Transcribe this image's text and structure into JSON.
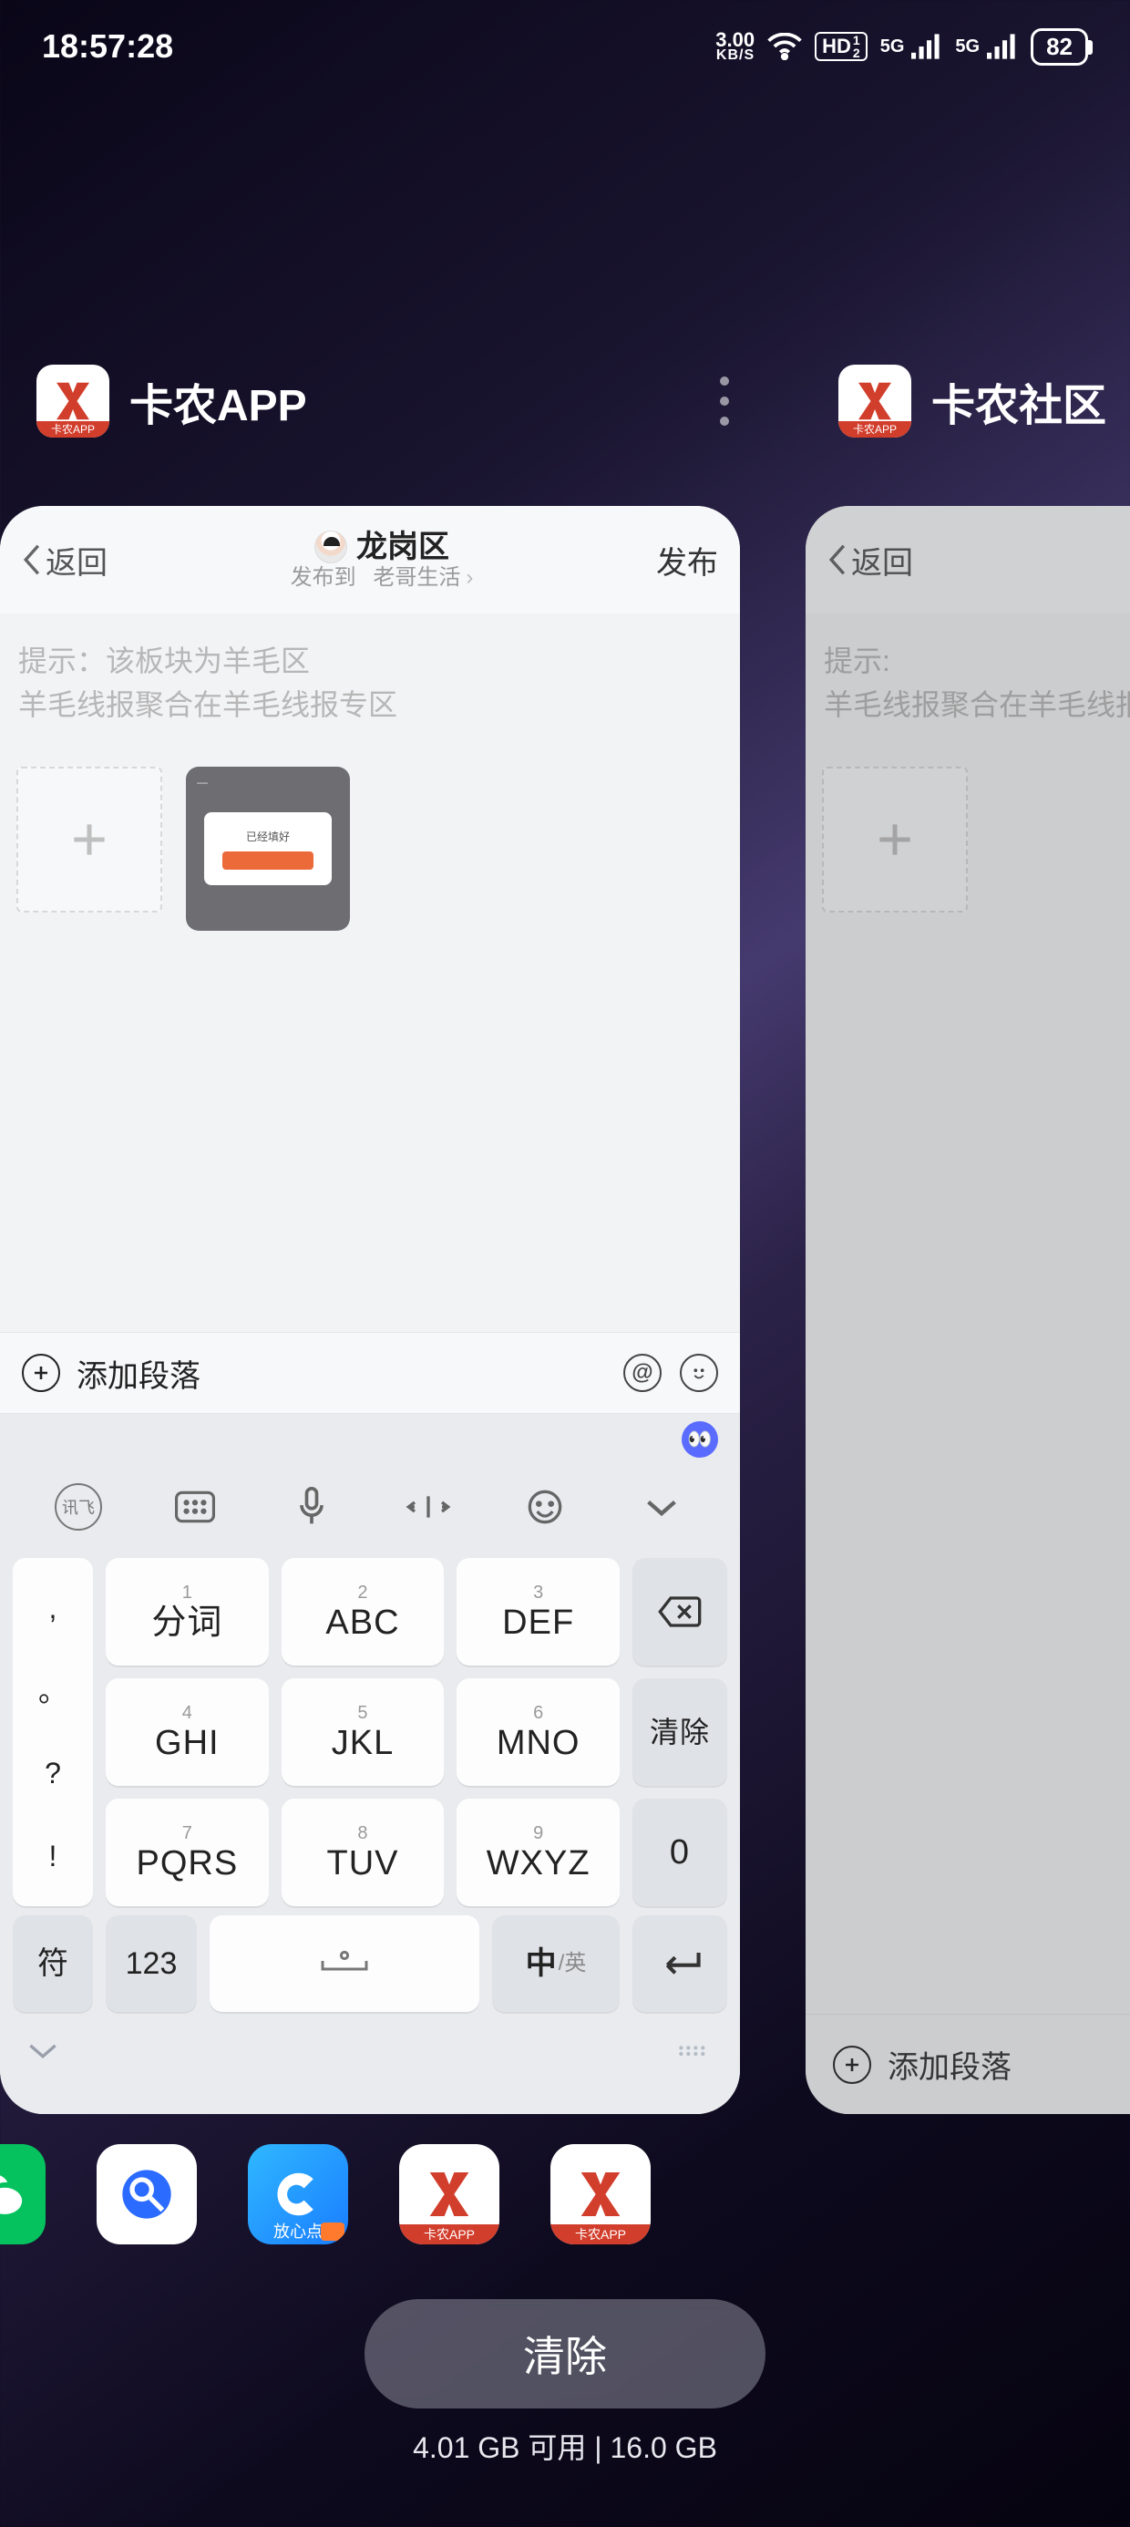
{
  "status": {
    "time": "18:57:28",
    "net_speed": "3.00",
    "net_unit": "KB/S",
    "hd": "HD",
    "g": "5G",
    "battery": "82"
  },
  "apps": {
    "a": {
      "title": "卡农APP",
      "icon_caption": "卡农APP"
    },
    "b": {
      "title": "卡农社区",
      "icon_caption": "卡农APP"
    }
  },
  "post": {
    "back": "返回",
    "loc": "龙岗区",
    "pub_to_label": "发布到",
    "pub_to_value": "老哥生活",
    "publish": "发布",
    "hint_a_line1": "提示：该板块为羊毛区",
    "hint_a_line2": "羊毛线报聚合在羊毛线报专区",
    "hint_b_line1": "提示:",
    "hint_b_line2": "羊毛线报聚合在羊毛线报专区",
    "add_para": "添加段落",
    "shot_txt": "已经填好"
  },
  "keyboard": {
    "row1_punct": [
      ",",
      "。",
      "?",
      "!"
    ],
    "keys": [
      {
        "n": "1",
        "m": "分词"
      },
      {
        "n": "2",
        "m": "ABC"
      },
      {
        "n": "3",
        "m": "DEF"
      },
      {
        "n": "4",
        "m": "GHI"
      },
      {
        "n": "5",
        "m": "JKL"
      },
      {
        "n": "6",
        "m": "MNO"
      },
      {
        "n": "7",
        "m": "PQRS"
      },
      {
        "n": "8",
        "m": "TUV"
      },
      {
        "n": "9",
        "m": "WXYZ"
      }
    ],
    "right": [
      "",
      "清除",
      "0"
    ],
    "bottom": {
      "sym": "符",
      "num": "123",
      "lang_main": "中",
      "lang_alt": "/英"
    },
    "ime_label": "讯飞"
  },
  "dock": [
    "微信",
    "搜索",
    "放心点",
    "卡农APP",
    "卡农APP"
  ],
  "clear_btn": "清除",
  "memory": {
    "free": "4.01 GB 可用",
    "total": "16.0 GB"
  }
}
